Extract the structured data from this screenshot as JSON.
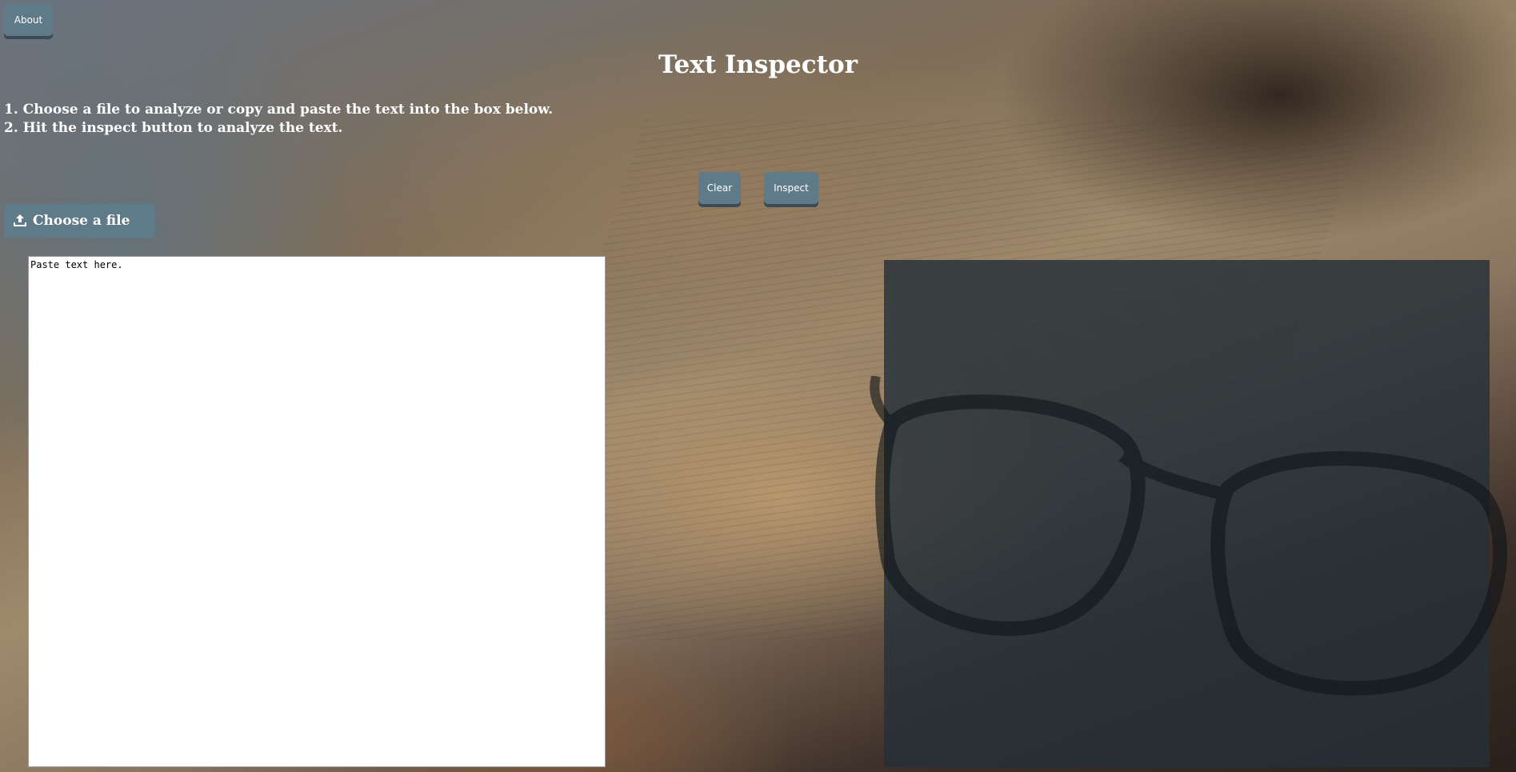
{
  "header": {
    "about_label": "About",
    "title": "Text Inspector"
  },
  "instructions": {
    "step1": "1. Choose a file to analyze or copy and paste the text into the box below.",
    "step2": "2. Hit the inspect button to analyze the text."
  },
  "actions": {
    "clear_label": "Clear",
    "inspect_label": "Inspect"
  },
  "file_upload": {
    "label": "Choose a file",
    "icon": "upload-icon"
  },
  "editor": {
    "placeholder": "Paste text here.",
    "value": ""
  },
  "results": {}
}
